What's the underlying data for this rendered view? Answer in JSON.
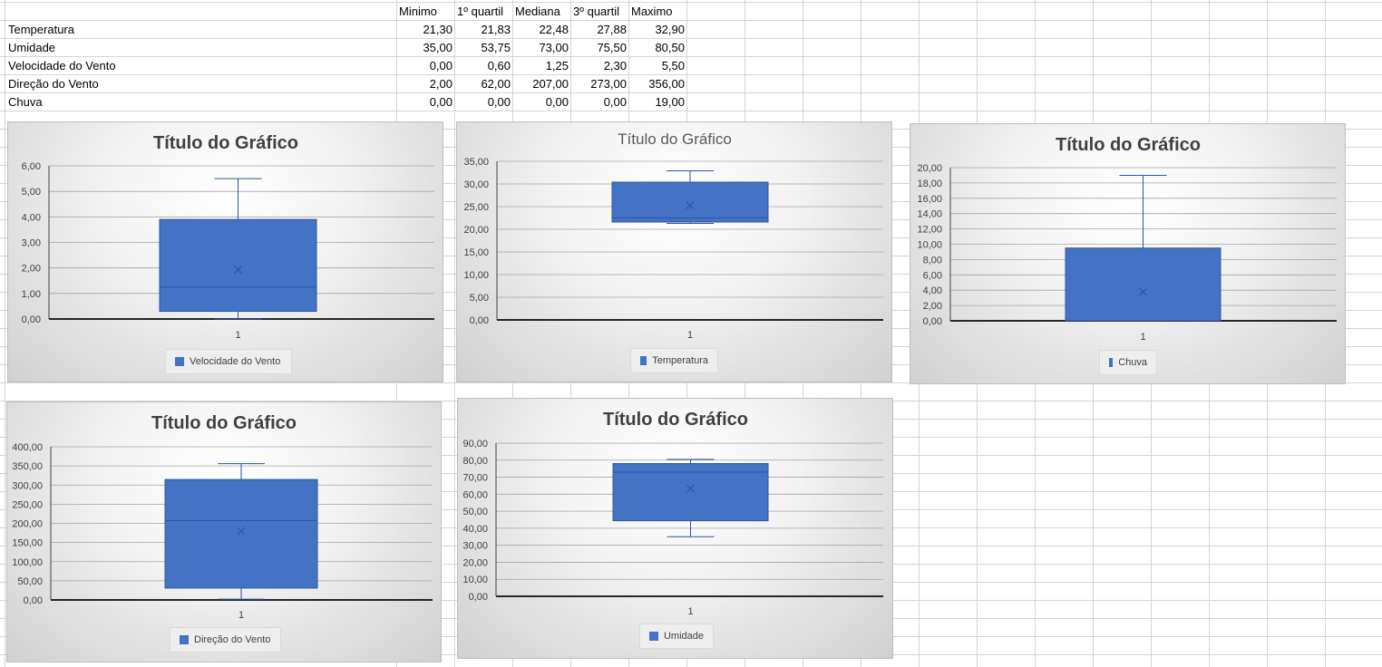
{
  "table": {
    "headers": [
      "Minimo",
      "1º quartil",
      "Mediana",
      "3º quartil",
      "Maximo"
    ],
    "rows": [
      {
        "label": "Temperatura",
        "values": [
          "21,30",
          "21,83",
          "22,48",
          "27,88",
          "32,90"
        ]
      },
      {
        "label": "Umidade",
        "values": [
          "35,00",
          "53,75",
          "73,00",
          "75,50",
          "80,50"
        ]
      },
      {
        "label": "Velocidade do Vento",
        "values": [
          "0,00",
          "0,60",
          "1,25",
          "2,30",
          "5,50"
        ]
      },
      {
        "label": "Direção do Vento",
        "values": [
          "2,00",
          "62,00",
          "207,00",
          "273,00",
          "356,00"
        ]
      },
      {
        "label": "Chuva",
        "values": [
          "0,00",
          "0,00",
          "0,00",
          "0,00",
          "19,00"
        ]
      }
    ]
  },
  "colors": {
    "box": "#4472c4",
    "whisker": "#2f5597",
    "grid": "#a6a6a6"
  },
  "chart_data": [
    {
      "type": "box",
      "title": "Título do Gráfico",
      "legend": "Velocidade do Vento",
      "categories": [
        "1"
      ],
      "ymin": 0,
      "ymax": 6,
      "ystep": 1,
      "yticks": [
        "0,00",
        "1,00",
        "2,00",
        "3,00",
        "4,00",
        "5,00",
        "6,00"
      ],
      "box": {
        "whisker_low": 0.0,
        "q1": 0.3,
        "median": 1.25,
        "q3": 3.9,
        "whisker_high": 5.5,
        "mean": 1.93
      }
    },
    {
      "type": "box",
      "title": "Título do Gráfico",
      "legend": "Temperatura",
      "categories": [
        "1"
      ],
      "ymin": 0,
      "ymax": 35,
      "ystep": 5,
      "yticks": [
        "0,00",
        "5,00",
        "10,00",
        "15,00",
        "20,00",
        "25,00",
        "30,00",
        "35,00"
      ],
      "box": {
        "whisker_low": 21.3,
        "q1": 21.6,
        "median": 22.5,
        "q3": 30.4,
        "whisker_high": 32.9,
        "mean": 25.3
      }
    },
    {
      "type": "box",
      "title": "Título do Gráfico",
      "legend": "Chuva",
      "categories": [
        "1"
      ],
      "ymin": 0,
      "ymax": 20,
      "ystep": 2,
      "yticks": [
        "0,00",
        "2,00",
        "4,00",
        "6,00",
        "8,00",
        "10,00",
        "12,00",
        "14,00",
        "16,00",
        "18,00",
        "20,00"
      ],
      "box": {
        "whisker_low": 0.0,
        "q1": 0.0,
        "median": 0.0,
        "q3": 9.5,
        "whisker_high": 19.0,
        "mean": 3.8
      }
    },
    {
      "type": "box",
      "title": "Título do Gráfico",
      "legend": "Direção do Vento",
      "categories": [
        "1"
      ],
      "ymin": 0,
      "ymax": 400,
      "ystep": 50,
      "yticks": [
        "0,00",
        "50,00",
        "100,00",
        "150,00",
        "200,00",
        "250,00",
        "300,00",
        "350,00",
        "400,00"
      ],
      "box": {
        "whisker_low": 2.0,
        "q1": 31.0,
        "median": 207.0,
        "q3": 314.5,
        "whisker_high": 356.0,
        "mean": 180.0
      }
    },
    {
      "type": "box",
      "title": "Título do Gráfico",
      "legend": "Umidade",
      "categories": [
        "1"
      ],
      "ymin": 0,
      "ymax": 90,
      "ystep": 10,
      "yticks": [
        "0,00",
        "10,00",
        "20,00",
        "30,00",
        "40,00",
        "50,00",
        "60,00",
        "70,00",
        "80,00",
        "90,00"
      ],
      "box": {
        "whisker_low": 35.0,
        "q1": 44.4,
        "median": 73.0,
        "q3": 78.0,
        "whisker_high": 80.5,
        "mean": 63.4
      }
    }
  ]
}
